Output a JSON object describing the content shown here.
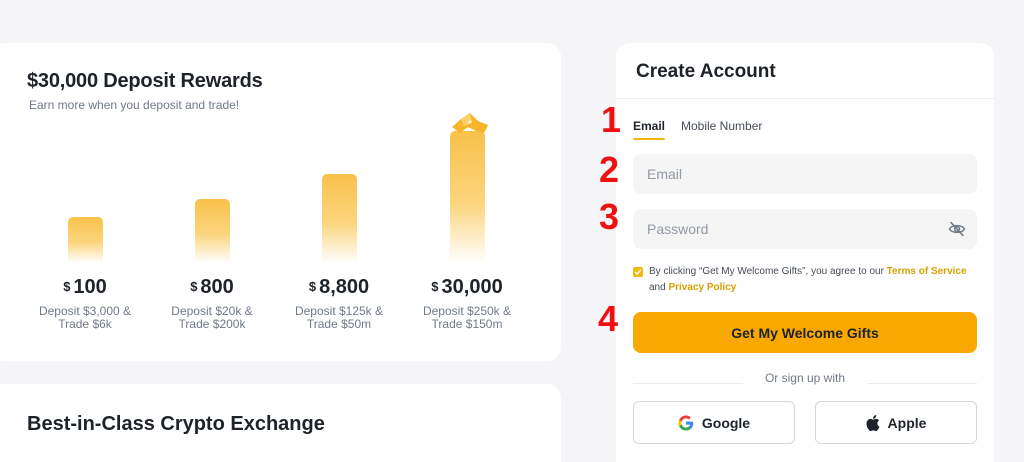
{
  "rewards": {
    "title": "$30,000 Deposit Rewards",
    "subtitle": "Earn more when you deposit and trade!",
    "currency": "$",
    "tiers": [
      {
        "amount": "100",
        "line1": "Deposit $3,000 &",
        "line2": "Trade $6k"
      },
      {
        "amount": "800",
        "line1": "Deposit $20k &",
        "line2": "Trade $200k"
      },
      {
        "amount": "8,800",
        "line1": "Deposit $125k &",
        "line2": "Trade $50m"
      },
      {
        "amount": "30,000",
        "line1": "Deposit $250k &",
        "line2": "Trade $150m"
      }
    ]
  },
  "exchange": {
    "title": "Best-in-Class Crypto Exchange"
  },
  "account": {
    "title": "Create Account",
    "tabs": [
      "Email",
      "Mobile Number"
    ],
    "email_placeholder": "Email",
    "password_placeholder": "Password",
    "terms_prefix": "By clicking “Get My Welcome Gifts”, you agree to our ",
    "terms_link": "Terms of Service",
    "terms_and": "and ",
    "privacy_link": "Privacy Policy",
    "submit_label": "Get My Welcome Gifts",
    "or_text": "Or sign up with",
    "google_label": "Google",
    "apple_label": "Apple"
  },
  "annotations": [
    "1",
    "2",
    "3",
    "4"
  ],
  "colors": {
    "accent": "#F0B90B",
    "button": "#F8A800",
    "annotation": "#EE1111"
  }
}
